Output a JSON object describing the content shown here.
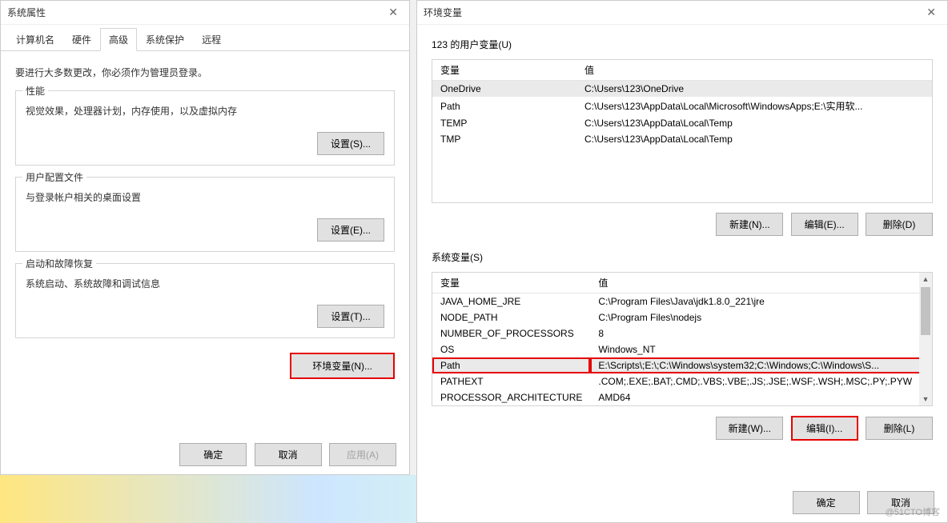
{
  "left": {
    "title": "系统属性",
    "tabs": [
      "计算机名",
      "硬件",
      "高级",
      "系统保护",
      "远程"
    ],
    "active_tab_index": 2,
    "admin_note": "要进行大多数更改，你必须作为管理员登录。",
    "groups": {
      "perf": {
        "legend": "性能",
        "desc": "视觉效果，处理器计划，内存使用，以及虚拟内存",
        "btn": "设置(S)..."
      },
      "profile": {
        "legend": "用户配置文件",
        "desc": "与登录帐户相关的桌面设置",
        "btn": "设置(E)..."
      },
      "startup": {
        "legend": "启动和故障恢复",
        "desc": "系统启动、系统故障和调试信息",
        "btn": "设置(T)..."
      }
    },
    "env_btn": "环境变量(N)...",
    "ok": "确定",
    "cancel": "取消",
    "apply": "应用(A)"
  },
  "right": {
    "title": "环境变量",
    "user_label": "123 的用户变量(U)",
    "sys_label": "系统变量(S)",
    "col_var": "变量",
    "col_val": "值",
    "user_vars": [
      {
        "name": "OneDrive",
        "value": "C:\\Users\\123\\OneDrive"
      },
      {
        "name": "Path",
        "value": "C:\\Users\\123\\AppData\\Local\\Microsoft\\WindowsApps;E:\\实用软..."
      },
      {
        "name": "TEMP",
        "value": "C:\\Users\\123\\AppData\\Local\\Temp"
      },
      {
        "name": "TMP",
        "value": "C:\\Users\\123\\AppData\\Local\\Temp"
      }
    ],
    "sys_vars": [
      {
        "name": "JAVA_HOME_JRE",
        "value": "C:\\Program Files\\Java\\jdk1.8.0_221\\jre"
      },
      {
        "name": "NODE_PATH",
        "value": "C:\\Program Files\\nodejs"
      },
      {
        "name": "NUMBER_OF_PROCESSORS",
        "value": "8"
      },
      {
        "name": "OS",
        "value": "Windows_NT"
      },
      {
        "name": "Path",
        "value": "E:\\Scripts\\;E:\\;C:\\Windows\\system32;C:\\Windows;C:\\Windows\\S..."
      },
      {
        "name": "PATHEXT",
        "value": ".COM;.EXE;.BAT;.CMD;.VBS;.VBE;.JS;.JSE;.WSF;.WSH;.MSC;.PY;.PYW"
      },
      {
        "name": "PROCESSOR_ARCHITECTURE",
        "value": "AMD64"
      }
    ],
    "sys_selected_index": 4,
    "user_highlight_index": 0,
    "user_btns": {
      "new": "新建(N)...",
      "edit": "编辑(E)...",
      "del": "删除(D)"
    },
    "sys_btns": {
      "new": "新建(W)...",
      "edit": "编辑(I)...",
      "del": "删除(L)"
    },
    "ok": "确定",
    "cancel": "取消"
  },
  "watermark": "@51CTO博客"
}
